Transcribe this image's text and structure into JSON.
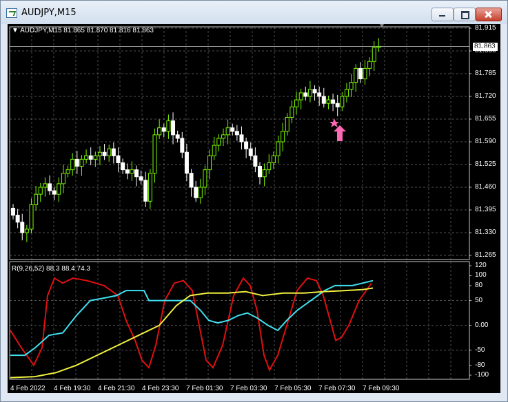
{
  "window": {
    "title": "AUDJPY,M15"
  },
  "chart": {
    "symbol_info": "AUDJPY,M15  81.865 81.870 81.816 81.863",
    "current_price": "81.863",
    "price_axis": [
      "81.915",
      "81.850",
      "81.785",
      "81.720",
      "81.655",
      "81.590",
      "81.525",
      "81.460",
      "81.395",
      "81.330",
      "81.265"
    ],
    "time_axis": [
      "4 Feb 2022",
      "4 Feb 19:30",
      "4 Feb 21:30",
      "4 Feb 23:30",
      "7 Feb 01:30",
      "7 Feb 03:30",
      "7 Feb 05:30",
      "7 Feb 07:30",
      "7 Feb 09:30"
    ],
    "colors": {
      "background": "#000000",
      "grid": "#c8c8c8",
      "bull_candle": "#7CFC00",
      "bear_candle": "#ffffff",
      "signal_arrow": "#ff69b4"
    },
    "signal": {
      "type": "buy-arrow",
      "marker": "star"
    }
  },
  "indicator": {
    "label": "R(9,26,52) 88.3 88.4 74.3",
    "scale_labels": [
      "120",
      "100",
      "80",
      "50",
      "0.00",
      "-50",
      "-80",
      "-100"
    ],
    "colors": {
      "line1": "#e01010",
      "line2": "#40e0f0",
      "line3": "#f0f040"
    }
  }
}
